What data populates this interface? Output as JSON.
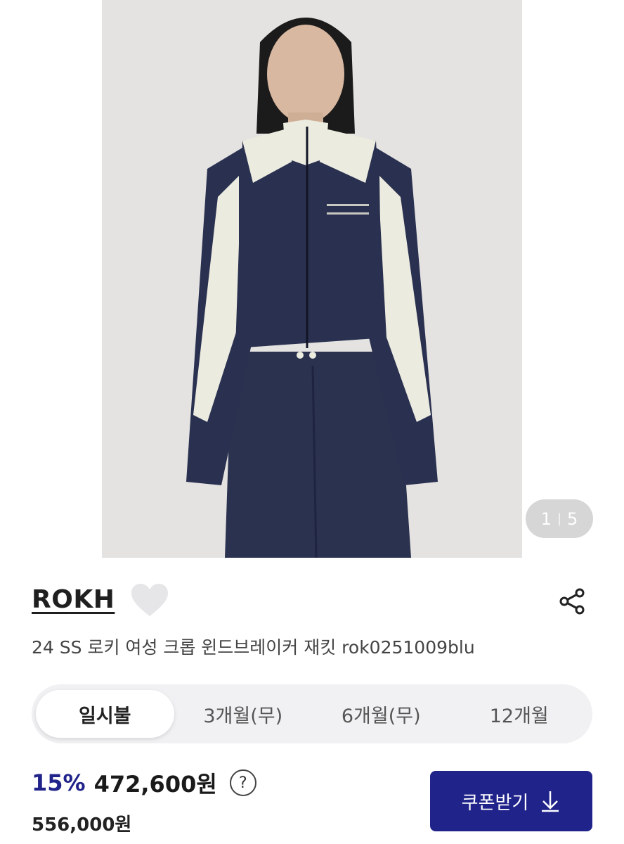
{
  "gallery": {
    "current": "1",
    "separator": "|",
    "total": "5"
  },
  "product": {
    "brand": "ROKH",
    "title": "24 SS 로키 여성 크롭 윈드브레이커 재킷 rok0251009blu"
  },
  "payment_tabs": [
    {
      "label": "일시불",
      "active": true
    },
    {
      "label": "3개월(무)",
      "active": false
    },
    {
      "label": "6개월(무)",
      "active": false
    },
    {
      "label": "12개월",
      "active": false
    }
  ],
  "pricing": {
    "discount": "15%",
    "price": "472,600원",
    "help_symbol": "?",
    "original_price": "556,000원"
  },
  "coupon": {
    "label": "쿠폰받기"
  },
  "icons": {
    "like": "heart-icon",
    "share": "share-icon",
    "help": "question-icon",
    "download": "arrow-down-icon"
  },
  "colors": {
    "accent": "#20238a",
    "tab_bg": "#f1f1f3",
    "photo_bg": "#e4e3e1",
    "jacket_navy": "#2a3150",
    "jacket_cream": "#ecebe0"
  }
}
